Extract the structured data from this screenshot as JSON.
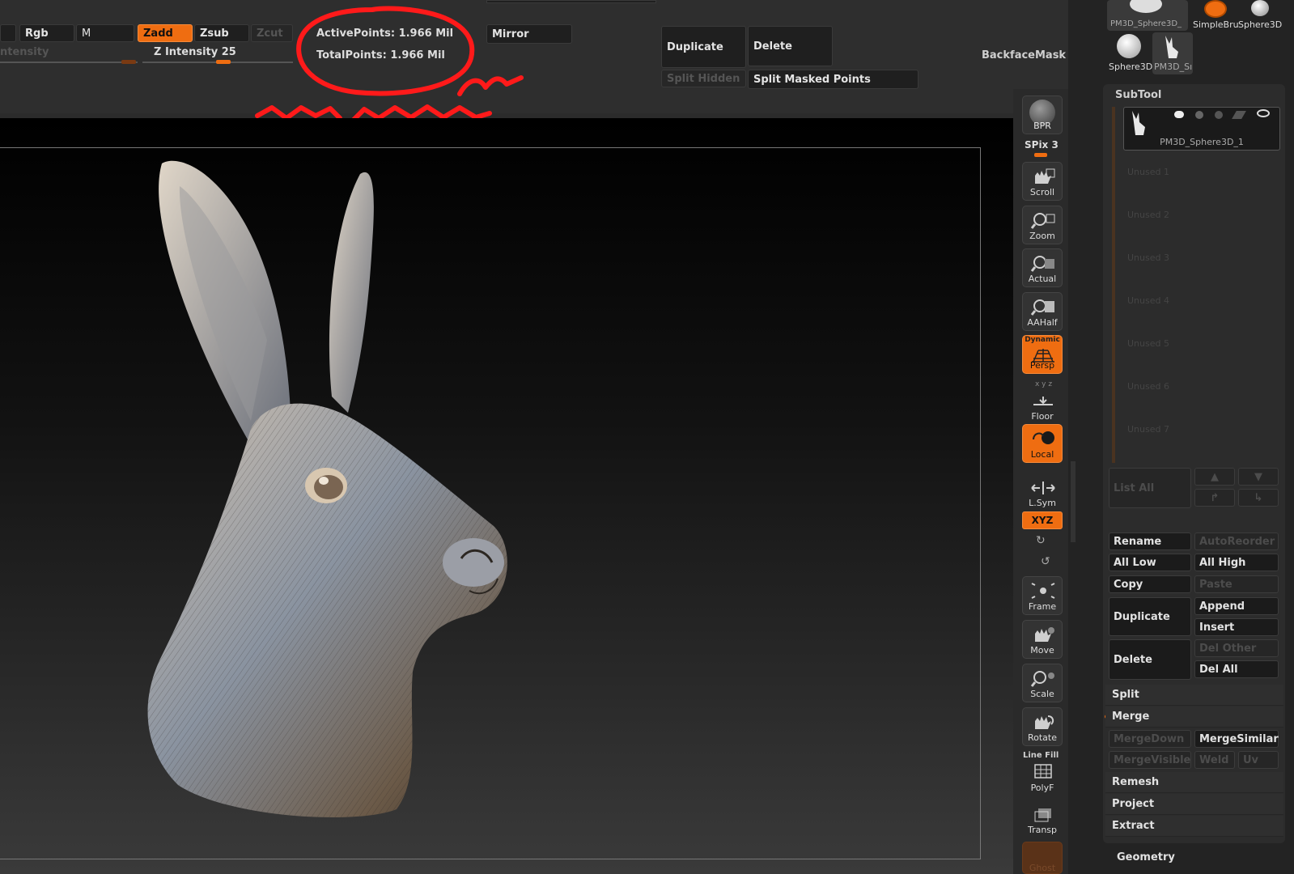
{
  "toolbar": {
    "rgb": "Rgb",
    "m": "M",
    "zadd": "Zadd",
    "zsub": "Zsub",
    "zcut": "Zcut",
    "intensity": "ntensity",
    "z_intensity": "Z Intensity 25",
    "active_points": "ActivePoints: 1.966 Mil",
    "total_points": "TotalPoints: 1.966 Mil",
    "mirror": "Mirror",
    "duplicate": "Duplicate",
    "delete": "Delete",
    "split_hidden": "Split Hidden",
    "split_masked": "Split Masked Points",
    "backface_mask": "BackfaceMask"
  },
  "shelf": {
    "bpr": "BPR",
    "spix": "SPix 3",
    "scroll": "Scroll",
    "zoom": "Zoom",
    "actual": "Actual",
    "aahalf": "AAHalf",
    "dynamic": "Dynamic",
    "persp": "Persp",
    "floor": "Floor",
    "local": "Local",
    "lsym": "L.Sym",
    "xyz": "XYZ",
    "frame": "Frame",
    "move": "Move",
    "scale": "Scale",
    "rotate": "Rotate",
    "line_fill": "Line Fill",
    "polyf": "PolyF",
    "transp": "Transp",
    "ghost": "Ghost"
  },
  "tool_thumbs": {
    "t1": "PM3D_Sphere3D_",
    "t2": "SimpleBru",
    "t3": "Sphere3D",
    "t4": "Sphere3D",
    "t5": "PM3D_Sı"
  },
  "subtool": {
    "title": "SubTool",
    "active_name": "PM3D_Sphere3D_1",
    "unused": [
      "Unused 1",
      "Unused 2",
      "Unused 3",
      "Unused 4",
      "Unused 5",
      "Unused 6",
      "Unused 7"
    ],
    "list_all": "List All",
    "rename": "Rename",
    "autoreorder": "AutoReorder",
    "all_low": "All Low",
    "all_high": "All High",
    "copy": "Copy",
    "paste": "Paste",
    "duplicate": "Duplicate",
    "append": "Append",
    "insert": "Insert",
    "delete": "Delete",
    "del_other": "Del Other",
    "del_all": "Del All",
    "split": "Split",
    "merge": "Merge",
    "mergedown": "MergeDown",
    "mergesimilar": "MergeSimilar",
    "mergevisible": "MergeVisible",
    "weld": "Weld",
    "uv": "Uv",
    "remesh": "Remesh",
    "project": "Project",
    "extract": "Extract",
    "geometry": "Geometry"
  },
  "colors": {
    "accent": "#ef6d11",
    "annotation": "#ff1a1a"
  }
}
